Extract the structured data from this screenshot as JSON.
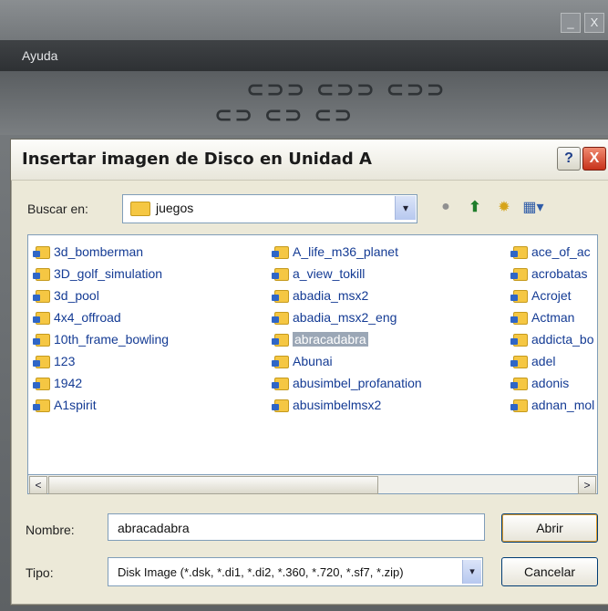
{
  "background_window": {
    "menu": "Ayuda",
    "window_buttons": [
      "_",
      "X"
    ]
  },
  "dialog": {
    "title": "Insertar imagen de Disco en Unidad A",
    "help_label": "?",
    "close_label": "X",
    "look_in_label": "Buscar en:",
    "look_in_value": "juegos",
    "combo_arrow": "▾",
    "toolbar": [
      "back-icon",
      "up-folder-icon",
      "new-folder-icon",
      "view-menu-icon"
    ],
    "files": {
      "col1": [
        "3d_bomberman",
        "3D_golf_simulation",
        "3d_pool",
        "4x4_offroad",
        "10th_frame_bowling",
        "123",
        "1942",
        "A1spirit"
      ],
      "col2": [
        "A_life_m36_planet",
        "a_view_tokill",
        "abadia_msx2",
        "abadia_msx2_eng",
        "abracadabra",
        "Abunai",
        "abusimbel_profanation",
        "abusimbelmsx2"
      ],
      "col3": [
        "ace_of_ac",
        "acrobatas",
        "Acrojet",
        "Actman",
        "addicta_bo",
        "adel",
        "adonis",
        "adnan_mol"
      ],
      "selected": "abracadabra"
    },
    "scroll_left": "<",
    "scroll_right": ">",
    "name_label": "Nombre:",
    "name_value": "abracadabra",
    "type_label": "Tipo:",
    "type_value": "Disk Image (*.dsk, *.di1, *.di2, *.360, *.720, *.sf7, *.zip)",
    "open_button": "Abrir",
    "cancel_button": "Cancelar"
  }
}
